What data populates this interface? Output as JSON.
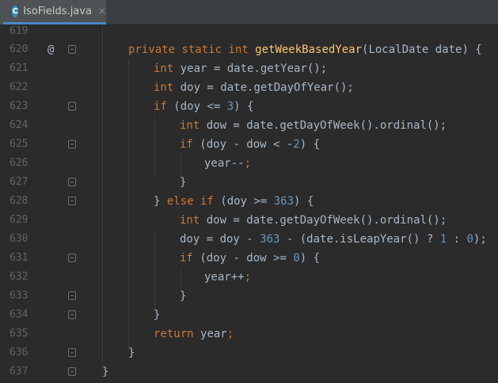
{
  "tab": {
    "icon_letter": "C",
    "filename": "IsoFields.java",
    "close_glyph": "×"
  },
  "gutter": {
    "override_marker": "@"
  },
  "lines": [
    {
      "num": "619"
    },
    {
      "num": "620",
      "parts": [
        "private static int ",
        "getWeekBasedYear",
        "(LocalDate date) {"
      ]
    },
    {
      "num": "621",
      "parts": [
        "int ",
        "year = date.getYear();"
      ]
    },
    {
      "num": "622",
      "parts": [
        "int ",
        "doy = date.getDayOfYear();"
      ]
    },
    {
      "num": "623",
      "parts": [
        "if ",
        "(doy <= ",
        "3",
        ") {"
      ]
    },
    {
      "num": "624",
      "parts": [
        "int ",
        "dow = date.getDayOfWeek().ordinal();"
      ]
    },
    {
      "num": "625",
      "parts": [
        "if ",
        "(doy - dow < -",
        "2",
        ") {"
      ]
    },
    {
      "num": "626",
      "parts": [
        "year--",
        ";"
      ]
    },
    {
      "num": "627",
      "parts": [
        "}"
      ]
    },
    {
      "num": "628",
      "parts": [
        "} ",
        "else if ",
        "(doy >= ",
        "363",
        ") {"
      ]
    },
    {
      "num": "629",
      "parts": [
        "int ",
        "dow = date.getDayOfWeek().ordinal();"
      ]
    },
    {
      "num": "630",
      "parts": [
        "doy = doy - ",
        "363 ",
        "- (date.isLeapYear() ? ",
        "1 ",
        ": ",
        "0",
        ");"
      ]
    },
    {
      "num": "631",
      "parts": [
        "if ",
        "(doy - dow >= ",
        "0",
        ") {"
      ]
    },
    {
      "num": "632",
      "parts": [
        "year++",
        ";"
      ]
    },
    {
      "num": "633",
      "parts": [
        "}"
      ]
    },
    {
      "num": "634",
      "parts": [
        "}"
      ]
    },
    {
      "num": "635",
      "parts": [
        "return ",
        "year",
        ";"
      ]
    },
    {
      "num": "636",
      "parts": [
        "}"
      ]
    },
    {
      "num": "637",
      "parts": [
        "}"
      ]
    }
  ]
}
